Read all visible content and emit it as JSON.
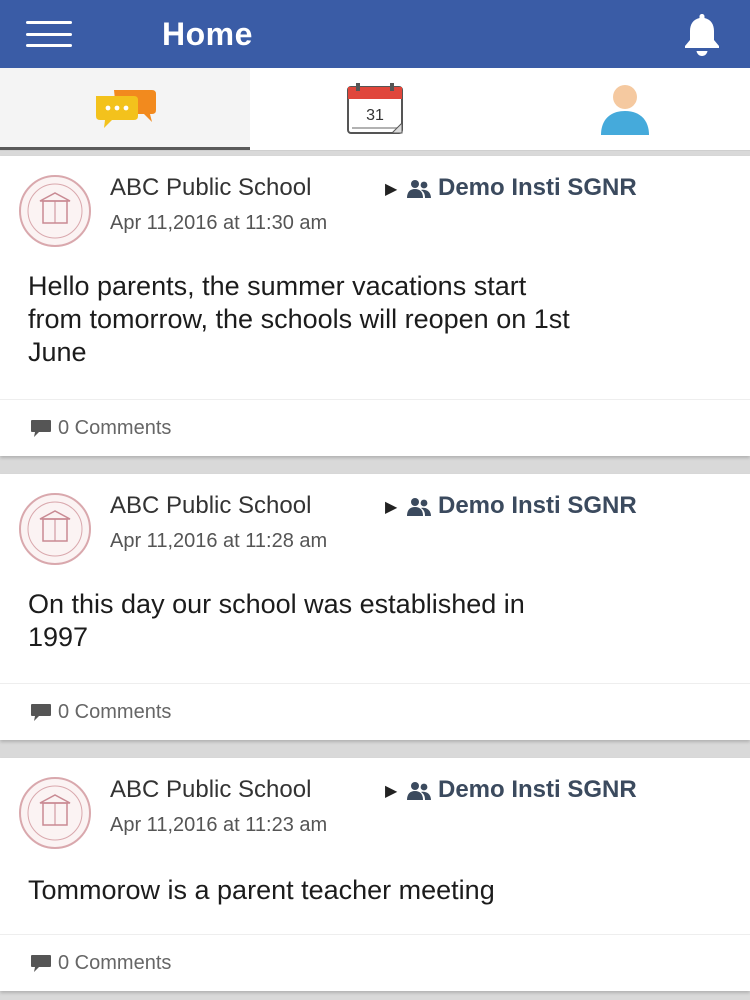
{
  "appbar": {
    "title": "Home",
    "menu_icon": "hamburger-menu-icon",
    "bell_icon": "bell-icon",
    "color": "#3a5ca6"
  },
  "tabs": [
    {
      "icon": "chat-bubbles-icon",
      "active": true
    },
    {
      "icon": "calendar-icon",
      "calendar_day": "31",
      "active": false
    },
    {
      "icon": "user-profile-icon",
      "active": false
    }
  ],
  "posts": [
    {
      "author": "ABC Public School",
      "group": "Demo Insti SGNR",
      "timestamp": "Apr 11,2016 at 11:30 am",
      "body_lines": [
        "Hello parents, the summer vacations start",
        "from tomorrow, the schools will reopen on 1st",
        "June"
      ],
      "comments": "0 Comments"
    },
    {
      "author": "ABC Public School",
      "group": "Demo Insti SGNR",
      "timestamp": "Apr 11,2016 at 11:28 am",
      "body_lines": [
        "On this day our school was established in",
        "1997"
      ],
      "comments": "0 Comments"
    },
    {
      "author": "ABC Public School",
      "group": "Demo Insti SGNR",
      "timestamp": "Apr 11,2016 at 11:23 am",
      "body_lines": [
        "Tommorow is a parent teacher meeting"
      ],
      "comments": "0 Comments"
    }
  ]
}
